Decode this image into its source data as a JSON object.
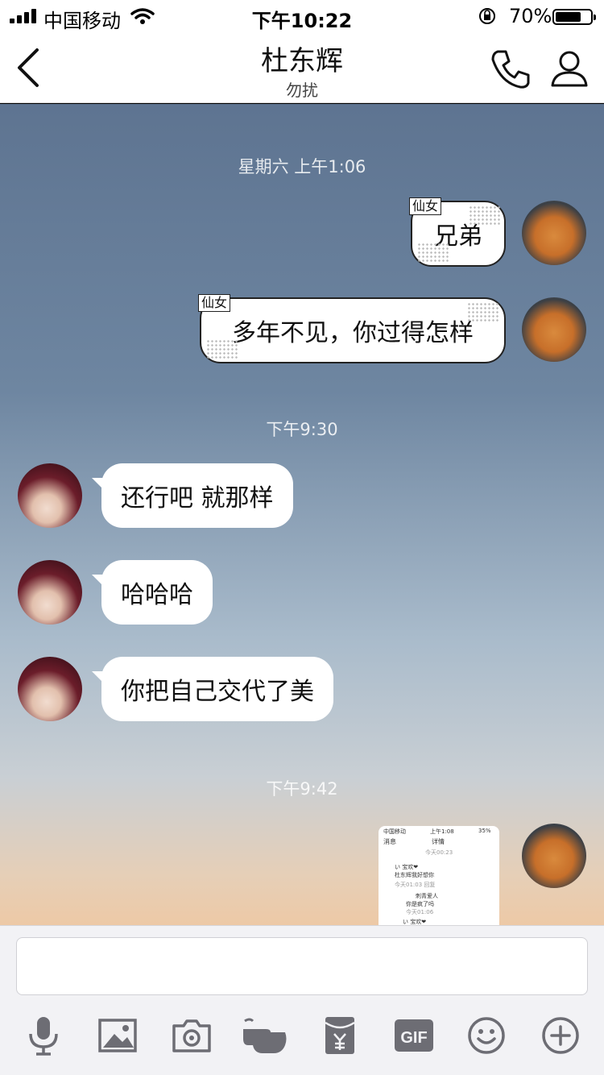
{
  "status_bar": {
    "carrier": "中国移动",
    "time": "下午10:22",
    "battery": "70%",
    "battery_level": 0.7
  },
  "header": {
    "title": "杜东辉",
    "subtitle": "勿扰"
  },
  "messages": {
    "ts1": "星期六 上午1:06",
    "m1_tag": "仙女",
    "m1": "兄弟",
    "m2_tag": "仙女",
    "m2": "多年不见，你过得怎样",
    "ts2": "下午9:30",
    "m3": "还行吧  就那样",
    "m4": "哈哈哈",
    "m5": "你把自己交代了美",
    "ts3": "下午9:42"
  },
  "screenshot_thumb": {
    "carrier": "中国移动",
    "time": "上午1:08",
    "battery": "35%",
    "back": "消息",
    "title": "详情",
    "date": "今天00:23",
    "user": "い   宝欢❤",
    "text": "杜东辉我好想你",
    "meta": "今天01:03    回复",
    "reply_user": "刺青爱人",
    "reply_text": "你是疯了吗",
    "reply_meta": "今天01:06",
    "last_user": "い   宝欢❤"
  },
  "toolbar": [
    "mic-icon",
    "image-icon",
    "camera-icon",
    "poke-icon",
    "red-packet-icon",
    "gif-icon",
    "emoji-icon",
    "plus-icon"
  ],
  "colors": {
    "icon": "#6d6d74",
    "bubble": "#ffffff"
  }
}
